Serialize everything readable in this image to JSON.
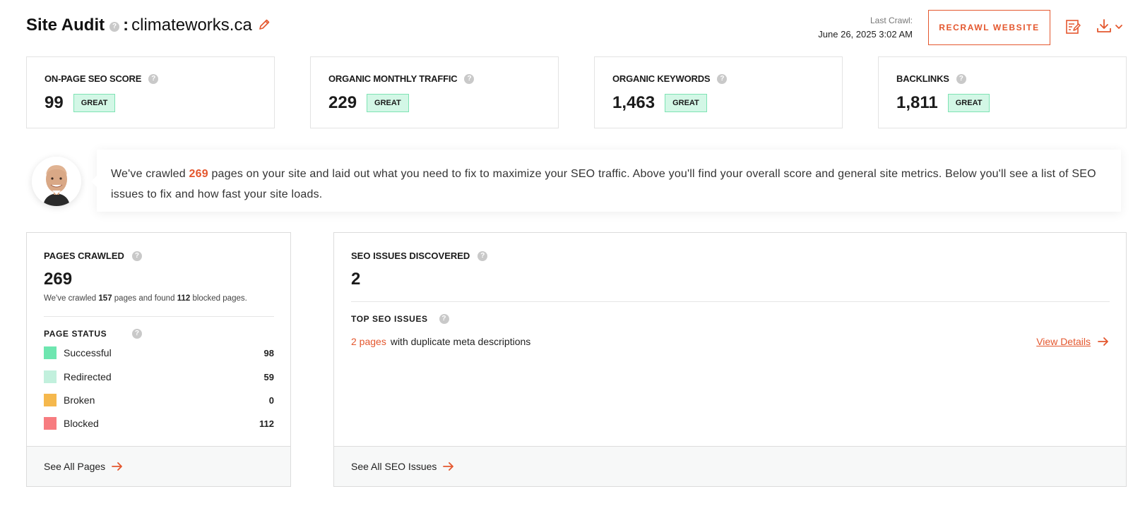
{
  "header": {
    "title": "Site Audit",
    "help_icon": "question-icon",
    "separator": ":",
    "domain": "climateworks.ca",
    "edit_icon": "pencil-icon",
    "last_crawl_label": "Last Crawl:",
    "last_crawl_value": "June 26, 2025 3:02 AM",
    "recrawl_label": "RECRAWL WEBSITE",
    "report_icon": "report-edit-icon",
    "download_icon": "download-icon",
    "accent_color": "#e4572e"
  },
  "metrics": [
    {
      "label": "ON-PAGE SEO SCORE",
      "value": "99",
      "badge": "GREAT"
    },
    {
      "label": "ORGANIC MONTHLY TRAFFIC",
      "value": "229",
      "badge": "GREAT"
    },
    {
      "label": "ORGANIC KEYWORDS",
      "value": "1,463",
      "badge": "GREAT"
    },
    {
      "label": "BACKLINKS",
      "value": "1,811",
      "badge": "GREAT"
    }
  ],
  "message": {
    "prefix": "We've crawled ",
    "count": "269",
    "suffix": " pages on your site and laid out what you need to fix to maximize your SEO traffic. Above you'll find your overall score and general site metrics. Below you'll see a list of SEO issues to fix and how fast your site loads."
  },
  "pages_crawled": {
    "label": "PAGES CRAWLED",
    "value": "269",
    "note_prefix": "We've crawled ",
    "note_crawled": "157",
    "note_mid": " pages and found ",
    "note_blocked": "112",
    "note_suffix": " blocked pages.",
    "status_label": "PAGE STATUS",
    "statuses": [
      {
        "label": "Successful",
        "count": "98",
        "color": "#6ee6b0"
      },
      {
        "label": "Redirected",
        "count": "59",
        "color": "#c2f0dd"
      },
      {
        "label": "Broken",
        "count": "0",
        "color": "#f5b84d"
      },
      {
        "label": "Blocked",
        "count": "112",
        "color": "#f77c80"
      }
    ],
    "footer": "See All Pages"
  },
  "seo_issues": {
    "label": "SEO ISSUES DISCOVERED",
    "value": "2",
    "top_label": "TOP SEO ISSUES",
    "issue_link": "2 pages",
    "issue_text": "with duplicate meta descriptions",
    "view_details": "View Details",
    "footer": "See All SEO Issues"
  }
}
